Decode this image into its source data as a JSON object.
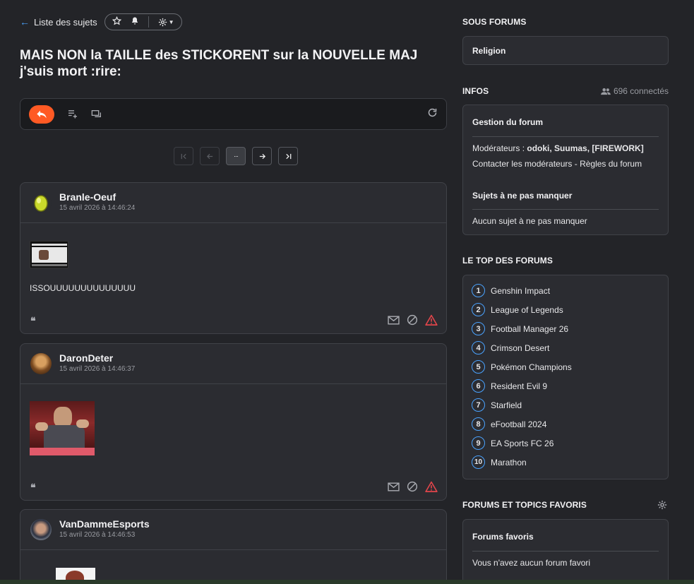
{
  "topic": {
    "back_label": "Liste des sujets",
    "title": "MAIS NON la TAILLE des STICKORENT sur la NOUVELLE MAJ j'suis mort :rire:"
  },
  "pagination": {
    "dots": "···"
  },
  "posts": [
    {
      "author": "Branle-Oeuf",
      "date": "15 avril 2026 à 14:46:24",
      "text": "ISSOUUUUUUUUUUUUUU"
    },
    {
      "author": "DaronDeter",
      "date": "15 avril 2026 à 14:46:37",
      "text": ""
    },
    {
      "author": "VanDammeEsports",
      "date": "15 avril 2026 à 14:46:53",
      "text": ""
    }
  ],
  "sidebar": {
    "sous_forums": {
      "title": "SOUS FORUMS",
      "item": "Religion"
    },
    "infos": {
      "title": "INFOS",
      "connected": "696 connectés",
      "gestion_title": "Gestion du forum",
      "moderators_label": "Modérateurs : ",
      "moderators": "odoki, Suumas, [FIREWORK]",
      "contact": "Contacter les modérateurs - Règles du forum",
      "must_title": "Sujets à ne pas manquer",
      "must_empty": "Aucun sujet à ne pas manquer"
    },
    "top": {
      "title": "LE TOP DES FORUMS",
      "items": [
        {
          "n": "1",
          "label": "Genshin Impact"
        },
        {
          "n": "2",
          "label": "League of Legends"
        },
        {
          "n": "3",
          "label": "Football Manager 26"
        },
        {
          "n": "4",
          "label": "Crimson Desert"
        },
        {
          "n": "5",
          "label": "Pokémon Champions"
        },
        {
          "n": "6",
          "label": "Resident Evil 9"
        },
        {
          "n": "7",
          "label": "Starfield"
        },
        {
          "n": "8",
          "label": "eFootball 2024"
        },
        {
          "n": "9",
          "label": "EA Sports FC 26"
        },
        {
          "n": "10",
          "label": "Marathon"
        }
      ]
    },
    "favoris": {
      "title": "FORUMS ET TOPICS FAVORIS",
      "forums_title": "Forums favoris",
      "forums_empty": "Vous n'avez aucun forum favori"
    }
  },
  "colors": {
    "accent": "#ff5a24",
    "link": "#4aa3ff",
    "danger": "#e0454a"
  }
}
